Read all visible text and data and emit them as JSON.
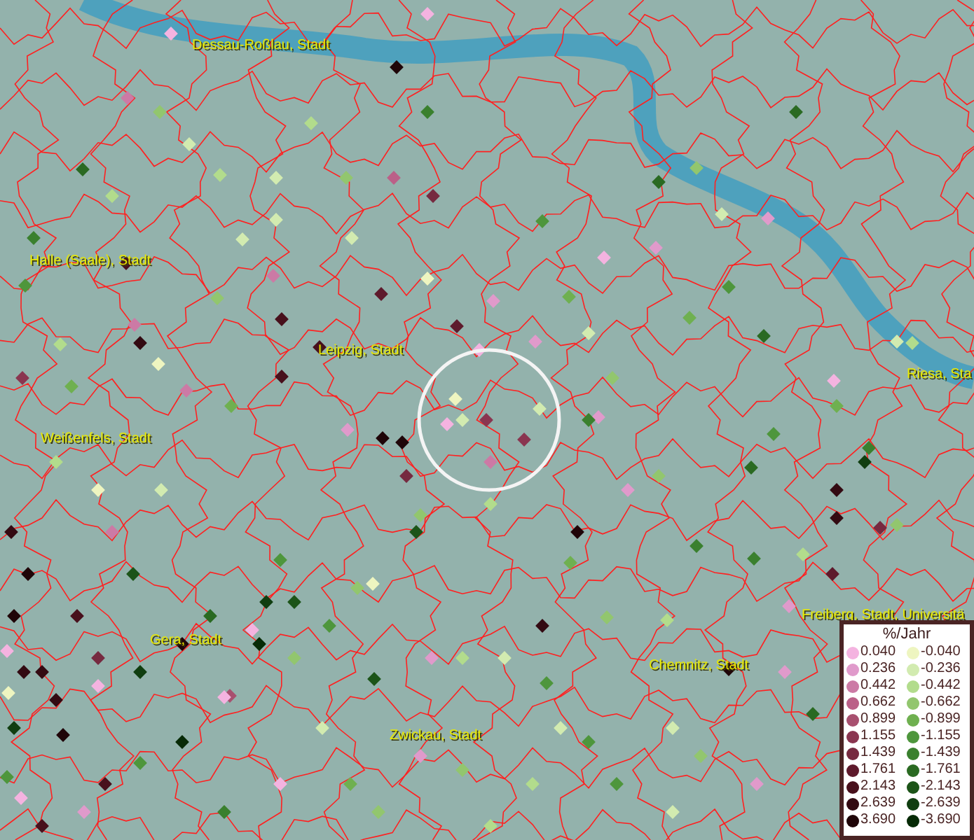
{
  "map": {
    "city_labels": [
      {
        "text": "Dessau-Roßlau, Stadt"
      },
      {
        "text": "Halle (Saale), Stadt"
      },
      {
        "text": "Leipzig, Stadt"
      },
      {
        "text": "Weißenfels, Stadt"
      },
      {
        "text": "Riesa, Sta"
      },
      {
        "text": "Freiberg, Stadt, Universitä"
      },
      {
        "text": "Gera, Stadt"
      },
      {
        "text": "Chemnitz, Stadt"
      },
      {
        "text": "Zwickau, Stadt"
      }
    ]
  },
  "legend": {
    "title": "%/Jahr",
    "columns": [
      [
        {
          "label": "0.040",
          "color": "#f4b3e0"
        },
        {
          "label": "0.236",
          "color": "#e09acb"
        },
        {
          "label": "0.442",
          "color": "#cc7aa5"
        },
        {
          "label": "0.662",
          "color": "#bb6088"
        },
        {
          "label": "0.899",
          "color": "#a8506f"
        },
        {
          "label": "1.155",
          "color": "#8a3550"
        },
        {
          "label": "1.439",
          "color": "#762a40"
        },
        {
          "label": "1.761",
          "color": "#5e1a2c"
        },
        {
          "label": "2.143",
          "color": "#48101c"
        },
        {
          "label": "2.639",
          "color": "#330a12"
        },
        {
          "label": "3.690",
          "color": "#1f0508"
        }
      ],
      [
        {
          "label": "-0.040",
          "color": "#eef5c0"
        },
        {
          "label": "-0.236",
          "color": "#d2ebb0"
        },
        {
          "label": "-0.442",
          "color": "#b2dc8c"
        },
        {
          "label": "-0.662",
          "color": "#92c66e"
        },
        {
          "label": "-0.899",
          "color": "#6fb050"
        },
        {
          "label": "-1.155",
          "color": "#4e963c"
        },
        {
          "label": "-1.439",
          "color": "#3a802e"
        },
        {
          "label": "-1.761",
          "color": "#2a6a22"
        },
        {
          "label": "-2.143",
          "color": "#1c5418"
        },
        {
          "label": "-2.639",
          "color": "#103e10"
        },
        {
          "label": "-3.690",
          "color": "#062a06"
        }
      ]
    ]
  }
}
